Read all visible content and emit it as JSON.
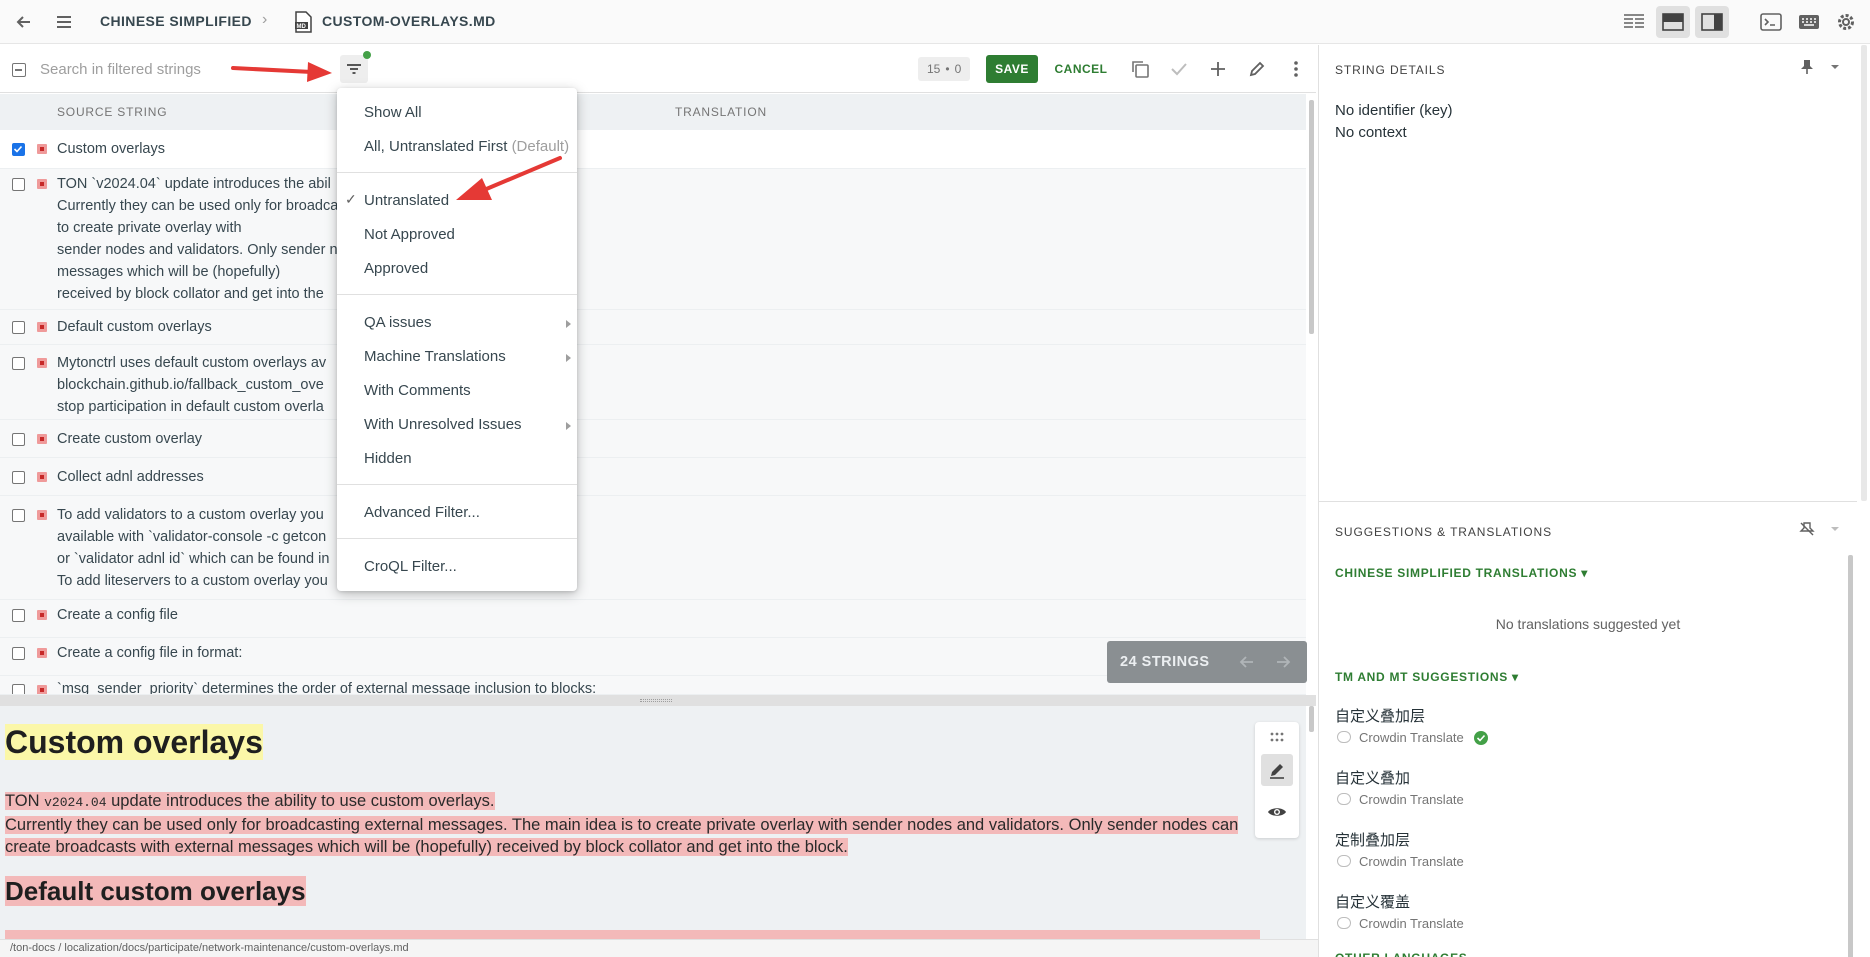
{
  "topbar": {
    "language": "CHINESE SIMPLIFIED",
    "file_name": "CUSTOM-OVERLAYS.MD"
  },
  "toolbar": {
    "search_placeholder": "Search in filtered strings",
    "counter_selected": "15",
    "counter_separator": "•",
    "counter_other": "0",
    "save_label": "SAVE",
    "cancel_label": "CANCEL"
  },
  "table": {
    "col_source": "SOURCE STRING",
    "col_translation": "TRANSLATION",
    "rows": [
      {
        "text": "Custom overlays",
        "checked": true
      },
      {
        "text": "TON `v2024.04` update introduces the abil\nCurrently they can be used only for broadca\nto create private overlay with\nsender nodes and validators. Only sender n\nmessages which will be (hopefully)\nreceived by block collator and get into the",
        "checked": false
      },
      {
        "text": "Default custom overlays",
        "checked": false
      },
      {
        "text": "Mytonctrl uses default custom overlays av\nblockchain.github.io/fallback_custom_ove\nstop participation in default custom overla",
        "checked": false
      },
      {
        "text": "Create custom overlay",
        "checked": false
      },
      {
        "text": "Collect adnl addresses",
        "checked": false
      },
      {
        "text": "To add validators to a custom overlay you\navailable with `validator-console -c getcon\nor `validator adnl id` which can be found in\nTo add liteservers to a custom overlay you",
        "checked": false
      },
      {
        "text": "Create a config file",
        "checked": false
      },
      {
        "text": "Create a config file in format:",
        "checked": false
      },
      {
        "text": "`msg_sender_priority` determines the order of external message inclusion to blocks:",
        "checked": false
      }
    ],
    "strings_count": "24 STRINGS"
  },
  "dropdown": {
    "show_all": "Show All",
    "all_untranslated_first": "All, Untranslated First",
    "default_tag": "(Default)",
    "untranslated": "Untranslated",
    "not_approved": "Not Approved",
    "approved": "Approved",
    "qa_issues": "QA issues",
    "machine_translations": "Machine Translations",
    "with_comments": "With Comments",
    "with_unresolved_issues": "With Unresolved Issues",
    "hidden": "Hidden",
    "advanced_filter": "Advanced Filter...",
    "croql_filter": "CroQL Filter..."
  },
  "preview": {
    "h1": "Custom overlays",
    "para_prefix": "TON ",
    "para_code": "v2024.04",
    "para_line1_rest": " update introduces the ability to use custom overlays.",
    "para_line2": "Currently they can be used only for broadcasting external messages. The main idea is to create private overlay with sender nodes and validators. Only sender nodes can",
    "para_line3": "create broadcasts with external messages which will be (hopefully) received by block collator and get into the block.",
    "h2": "Default custom overlays"
  },
  "statusbar": {
    "path": "/ton-docs / localization/docs/participate/network-maintenance/custom-overlays.md"
  },
  "right_panel": {
    "string_details_title": "STRING DETAILS",
    "no_identifier": "No identifier (key)",
    "no_context": "No context",
    "suggestions_title": "SUGGESTIONS & TRANSLATIONS",
    "translations_header": "CHINESE SIMPLIFIED TRANSLATIONS",
    "no_translations": "No translations suggested yet",
    "tm_header": "TM AND MT SUGGESTIONS",
    "suggestions": [
      {
        "text": "自定义叠加层",
        "source": "Crowdin Translate"
      },
      {
        "text": "自定义叠加",
        "source": "Crowdin Translate"
      },
      {
        "text": "定制叠加层",
        "source": "Crowdin Translate"
      },
      {
        "text": "自定义覆盖",
        "source": "Crowdin Translate"
      }
    ],
    "other_languages": "OTHER LANGUAGES"
  },
  "colors": {
    "accent_green": "#2e7d32",
    "arrow_red": "#e53935",
    "untranslated_red": "#c62828",
    "checkbox_blue": "#1a73e8"
  }
}
